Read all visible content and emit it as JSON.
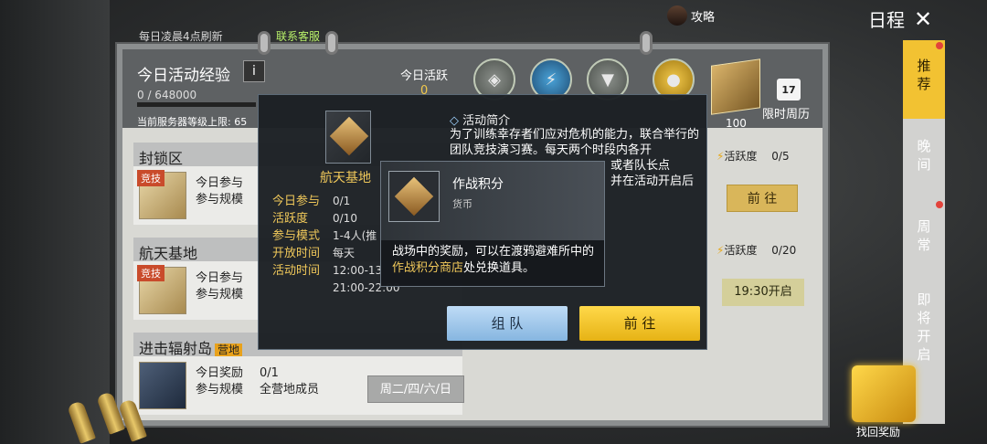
{
  "header": {
    "refresh_note": "每日凌晨4点刷新",
    "customer_service": "联系客服",
    "strategy_label": "攻略",
    "schedule_title": "日程"
  },
  "summary": {
    "title": "今日活动经验",
    "info_label": "i",
    "exp_value": "0 / 648000",
    "server_level_label": "当前服务器等级上限: 65",
    "active_label": "今日活跃",
    "active_value": "0",
    "reward_crate_count": "100",
    "weekly_label": "限时周历",
    "calendar_day": "17"
  },
  "activities": [
    {
      "name": "封锁区",
      "badge": "竞技",
      "row1_label": "今日参与",
      "row2_label": "参与规模",
      "active_label": "活跃度",
      "active_value": "0/5",
      "button": "前 往"
    },
    {
      "name": "航天基地",
      "badge": "竞技",
      "row1_label": "今日参与",
      "row2_label": "参与规模",
      "active_label": "活跃度",
      "active_value": "0/20",
      "button": "19:30开启"
    },
    {
      "name": "进击辐射岛",
      "tag": "营地",
      "row1_label": "今日奖励",
      "row1_value": "0/1",
      "row2_label": "参与规模",
      "row2_value": "全营地成员",
      "button": "周二/四/六/日"
    }
  ],
  "tabs": [
    {
      "label": "推荐",
      "active": true
    },
    {
      "label": "晚间",
      "active": false
    },
    {
      "label": "周常",
      "active": false
    },
    {
      "label": "即将开启",
      "active": false
    }
  ],
  "gift_label": "找回奖励",
  "popup": {
    "title": "航天基地",
    "fields": [
      {
        "label": "今日参与",
        "value": "0/1"
      },
      {
        "label": "活跃度",
        "value": "0/10"
      },
      {
        "label": "参与模式",
        "value": "1-4人(推"
      },
      {
        "label": "开放时间",
        "value": "每天"
      },
      {
        "label": "活动时间",
        "value": "12:00-13"
      },
      {
        "label": "",
        "value": "21:00-22:00"
      }
    ],
    "intro_title": "活动简介",
    "intro_text_1": "为了训练幸存者们应对危机的能力，联合举行的团队竞技演习赛。每天两个时段内各开",
    "intro_text_2": "或者队长点",
    "intro_text_3": "并在活动开启后",
    "team_button": "组 队",
    "go_button": "前 往"
  },
  "tooltip": {
    "title": "作战积分",
    "type": "货币",
    "desc_prefix": "战场中的奖励，可以在渡鸦避难所中的",
    "desc_highlight": "作战积分商店",
    "desc_suffix": "处兑换道具。"
  }
}
